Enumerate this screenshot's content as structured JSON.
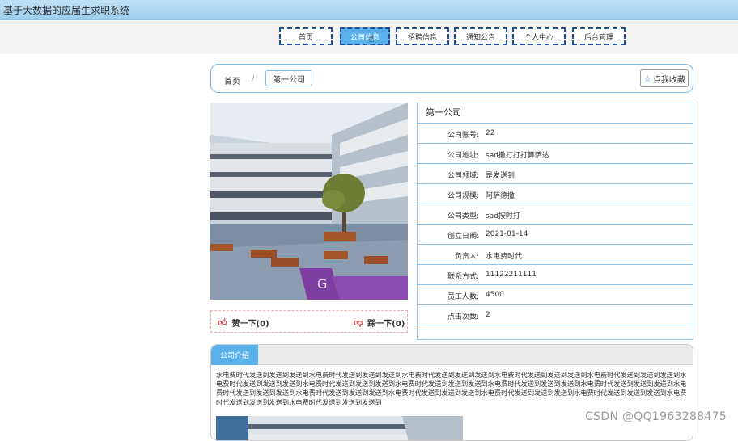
{
  "app": {
    "title": "基于大数据的应届生求职系统"
  },
  "nav": {
    "items": [
      {
        "label": "首页"
      },
      {
        "label": "公司信息",
        "active": true
      },
      {
        "label": "招聘信息"
      },
      {
        "label": "通知公告"
      },
      {
        "label": "个人中心"
      },
      {
        "label": "后台管理"
      }
    ]
  },
  "breadcrumb": {
    "home": "首页",
    "separator": "/",
    "current": "第一公司"
  },
  "favorite": {
    "label": "点我收藏",
    "icon": "star-outline-icon"
  },
  "company": {
    "name": "第一公司",
    "fields": [
      {
        "label": "公司账号:",
        "value": "22"
      },
      {
        "label": "公司地址:",
        "value": "sad撒打打打算萨达"
      },
      {
        "label": "公司领域:",
        "value": "是发送到"
      },
      {
        "label": "公司规模:",
        "value": "阿萨德撒"
      },
      {
        "label": "公司类型:",
        "value": "sad按时打"
      },
      {
        "label": "创立日期:",
        "value": "2021-01-14"
      },
      {
        "label": "负责人:",
        "value": "水电费时代"
      },
      {
        "label": "联系方式:",
        "value": "11122211111"
      },
      {
        "label": "员工人数:",
        "value": "4500"
      },
      {
        "label": "点击次数:",
        "value": "2"
      }
    ]
  },
  "votes": {
    "like_label": "赞一下(0)",
    "dislike_label": "踩一下(0)",
    "like_icon": "thumbs-up-icon",
    "dislike_icon": "thumbs-down-icon"
  },
  "intro": {
    "tab_label": "公司介绍",
    "text": "水电费时代发送到发送到发送到水电费时代发送到发送到发送到水电费时代发送到发送到发送到水电费时代发送到发送到发送到水电费时代发送到发送到发送到水电费时代发送到发送到发送到水电费时代发送到发送到发送到水电费时代发送到发送到发送到水电费时代发送到发送到发送到水电费时代发送到发送到发送到水电费时代发送到发送到发送到水电费时代发送到发送到发送到水电费时代发送到发送到发送到水电费时代发送到发送到发送到水电费时代发送到发送到发送到水电费时代发送到发送到发送到水电费时代发送到发送到发送到"
  },
  "watermark": "CSDN @QQ1963288475",
  "colors": {
    "accent": "#5ab0e8",
    "border": "#8fc4ea",
    "nav_border": "#1f4f9a"
  }
}
